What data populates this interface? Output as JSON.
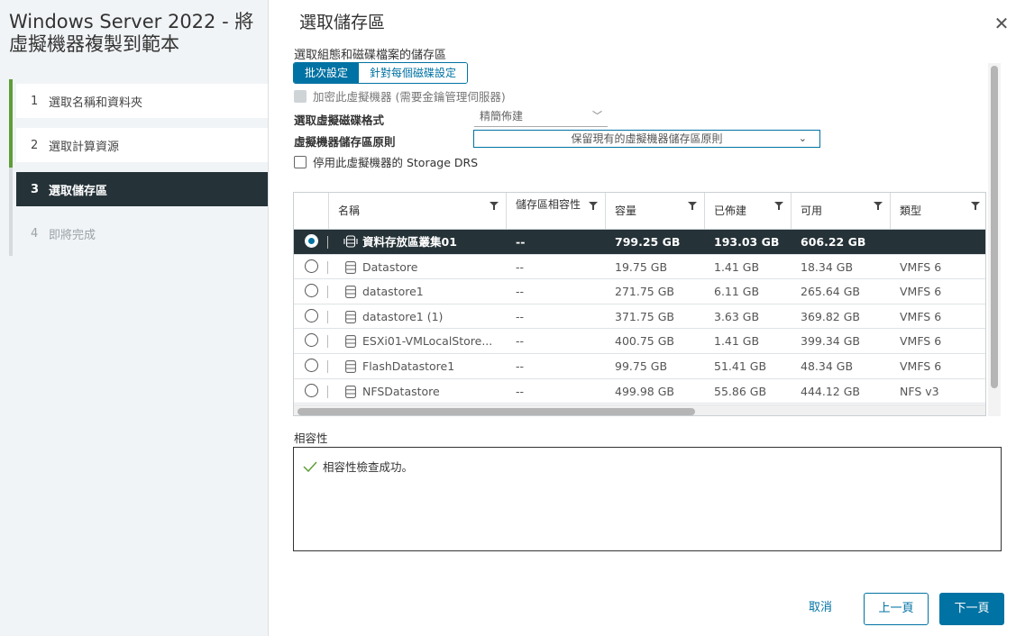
{
  "wizard": {
    "title": "Windows Server 2022 - 將虛擬機器複製到範本",
    "steps": [
      {
        "num": "1",
        "label": "選取名稱和資料夾"
      },
      {
        "num": "2",
        "label": "選取計算資源"
      },
      {
        "num": "3",
        "label": "選取儲存區"
      },
      {
        "num": "4",
        "label": "即將完成"
      }
    ]
  },
  "main": {
    "title": "選取儲存區",
    "section_label": "選取組態和磁碟檔案的儲存區",
    "segments": [
      "批次設定",
      "針對每個磁碟設定"
    ],
    "encrypt_label": "加密此虛擬機器 (需要金鑰管理伺服器)",
    "disk_format_label": "選取虛擬磁碟格式",
    "disk_format_value": "精簡佈建",
    "policy_label": "虛擬機器儲存區原則",
    "policy_value": "保留現有的虛擬機器儲存區原則",
    "sdrs_label": "停用此虛擬機器的 Storage DRS"
  },
  "grid": {
    "columns": [
      "名稱",
      "儲存區相容性",
      "容量",
      "已佈建",
      "可用",
      "類型"
    ],
    "rows": [
      {
        "name": "資料存放區叢集01",
        "compat": "--",
        "capacity": "799.25 GB",
        "provisioned": "193.03 GB",
        "free": "606.22 GB",
        "type": "",
        "icon": "datastore-cluster-icon"
      },
      {
        "name": "Datastore",
        "compat": "--",
        "capacity": "19.75 GB",
        "provisioned": "1.41 GB",
        "free": "18.34 GB",
        "type": "VMFS 6",
        "icon": "datastore-icon"
      },
      {
        "name": "datastore1",
        "compat": "--",
        "capacity": "271.75 GB",
        "provisioned": "6.11 GB",
        "free": "265.64 GB",
        "type": "VMFS 6",
        "icon": "datastore-icon"
      },
      {
        "name": "datastore1 (1)",
        "compat": "--",
        "capacity": "371.75 GB",
        "provisioned": "3.63 GB",
        "free": "369.82 GB",
        "type": "VMFS 6",
        "icon": "datastore-icon"
      },
      {
        "name": "ESXi01-VMLocalStore...",
        "compat": "--",
        "capacity": "400.75 GB",
        "provisioned": "1.41 GB",
        "free": "399.34 GB",
        "type": "VMFS 6",
        "icon": "datastore-icon"
      },
      {
        "name": "FlashDatastore1",
        "compat": "--",
        "capacity": "99.75 GB",
        "provisioned": "51.41 GB",
        "free": "48.34 GB",
        "type": "VMFS 6",
        "icon": "datastore-icon"
      },
      {
        "name": "NFSDatastore",
        "compat": "--",
        "capacity": "499.98 GB",
        "provisioned": "55.86 GB",
        "free": "444.12 GB",
        "type": "NFS v3",
        "icon": "datastore-icon"
      }
    ]
  },
  "compatibility": {
    "label": "相容性",
    "message": "相容性檢查成功。"
  },
  "footer": {
    "cancel": "取消",
    "back": "上一頁",
    "next": "下一頁"
  }
}
